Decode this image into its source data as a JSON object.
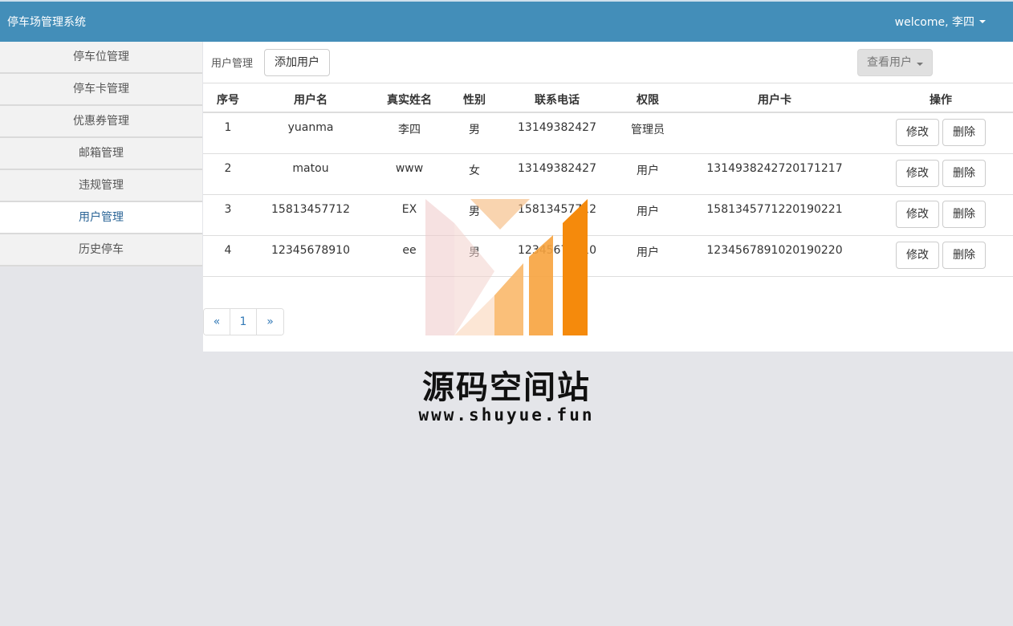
{
  "app": {
    "title": "停车场管理系统"
  },
  "user_menu": {
    "label": "welcome, 李四"
  },
  "sidebar": {
    "items": [
      {
        "label": "停车位管理"
      },
      {
        "label": "停车卡管理"
      },
      {
        "label": "优惠券管理"
      },
      {
        "label": "邮箱管理"
      },
      {
        "label": "违规管理"
      },
      {
        "label": "用户管理",
        "active": true
      },
      {
        "label": "历史停车"
      }
    ]
  },
  "toolbar": {
    "title": "用户管理",
    "add_label": "添加用户",
    "view_label": "查看用户"
  },
  "table": {
    "headers": [
      "序号",
      "用户名",
      "真实姓名",
      "性别",
      "联系电话",
      "权限",
      "用户卡",
      "操作"
    ],
    "rows": [
      {
        "id": "1",
        "username": "yuanma",
        "realname": "李四",
        "gender": "男",
        "phone": "13149382427",
        "role": "管理员",
        "card": ""
      },
      {
        "id": "2",
        "username": "matou",
        "realname": "www",
        "gender": "女",
        "phone": "13149382427",
        "role": "用户",
        "card": "1314938242720171217"
      },
      {
        "id": "3",
        "username": "15813457712",
        "realname": "EX",
        "gender": "男",
        "phone": "15813457712",
        "role": "用户",
        "card": "1581345771220190221"
      },
      {
        "id": "4",
        "username": "12345678910",
        "realname": "ee",
        "gender": "男",
        "phone": "12345678910",
        "role": "用户",
        "card": "1234567891020190220"
      }
    ],
    "edit_label": "修改",
    "delete_label": "删除"
  },
  "pagination": {
    "prev": "«",
    "page": "1",
    "next": "»"
  },
  "watermark": {
    "text": "源码空间站",
    "url": "www.shuyue.fun"
  },
  "colors": {
    "navbar": "#438eb9",
    "active_link": "#2a6496",
    "page_bg": "#e4e5e9"
  }
}
